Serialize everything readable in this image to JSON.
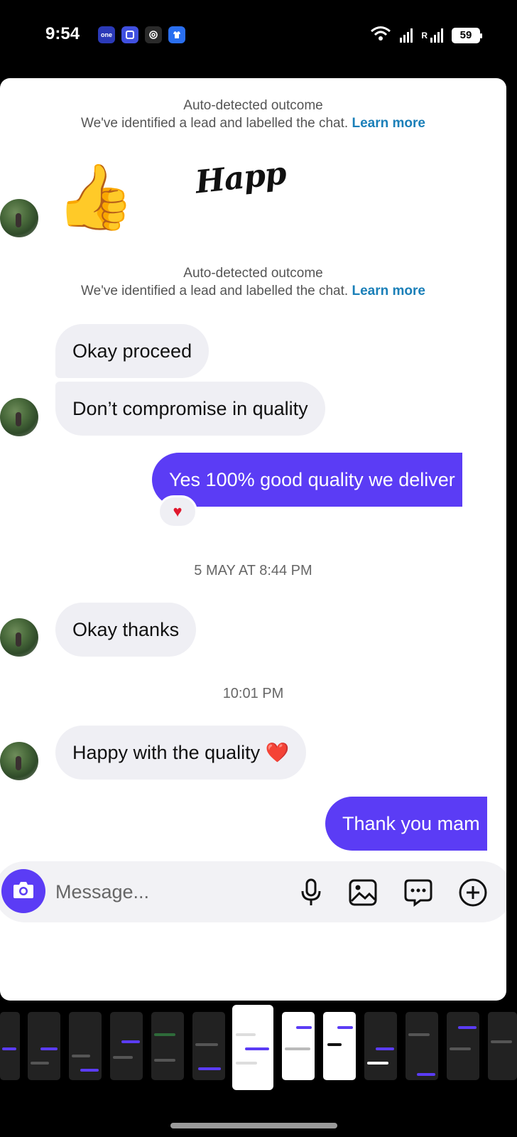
{
  "status_bar": {
    "time": "9:54",
    "apps": [
      {
        "icon": "one-app-icon",
        "label": "one",
        "color": "#2b3ab8"
      },
      {
        "icon": "app-square-icon",
        "label": "",
        "color": "#4050e0"
      },
      {
        "icon": "app-spiral-icon",
        "label": "",
        "color": "#2a2a2a"
      },
      {
        "icon": "app-shirt-icon",
        "label": "",
        "color": "#2a6ff0"
      }
    ],
    "roaming_label": "R",
    "battery": "59"
  },
  "conversation": {
    "notices": [
      {
        "title": "Auto-detected outcome",
        "text": "We've identified a lead and labelled the chat.",
        "link": "Learn more"
      },
      {
        "title": "Auto-detected outcome",
        "text": "We've identified a lead and labelled the chat.",
        "link": "Learn more"
      }
    ],
    "thumbs_emoji": "👍",
    "sticker_text": "Happ",
    "messages": [
      {
        "direction": "in",
        "text": "Okay proceed"
      },
      {
        "direction": "in",
        "text": "Don’t compromise in quality"
      },
      {
        "direction": "out",
        "text": "Yes 100% good quality we deliver",
        "reaction": "♥"
      },
      {
        "direction": "in",
        "text": "Okay thanks"
      },
      {
        "direction": "in",
        "text": "Happy with the quality ❤️"
      },
      {
        "direction": "out",
        "text": "Thank you mam"
      }
    ],
    "timestamps": [
      "5 MAY AT 8:44 PM",
      "10:01 PM"
    ]
  },
  "composer": {
    "placeholder": "Message...",
    "icons": [
      "camera-icon",
      "microphone-icon",
      "gallery-icon",
      "sticker-chat-icon",
      "plus-icon"
    ]
  },
  "colors": {
    "outgoing_bubble": "#5b3cf5",
    "incoming_bubble": "#efeff4",
    "link": "#1a7fb8"
  }
}
